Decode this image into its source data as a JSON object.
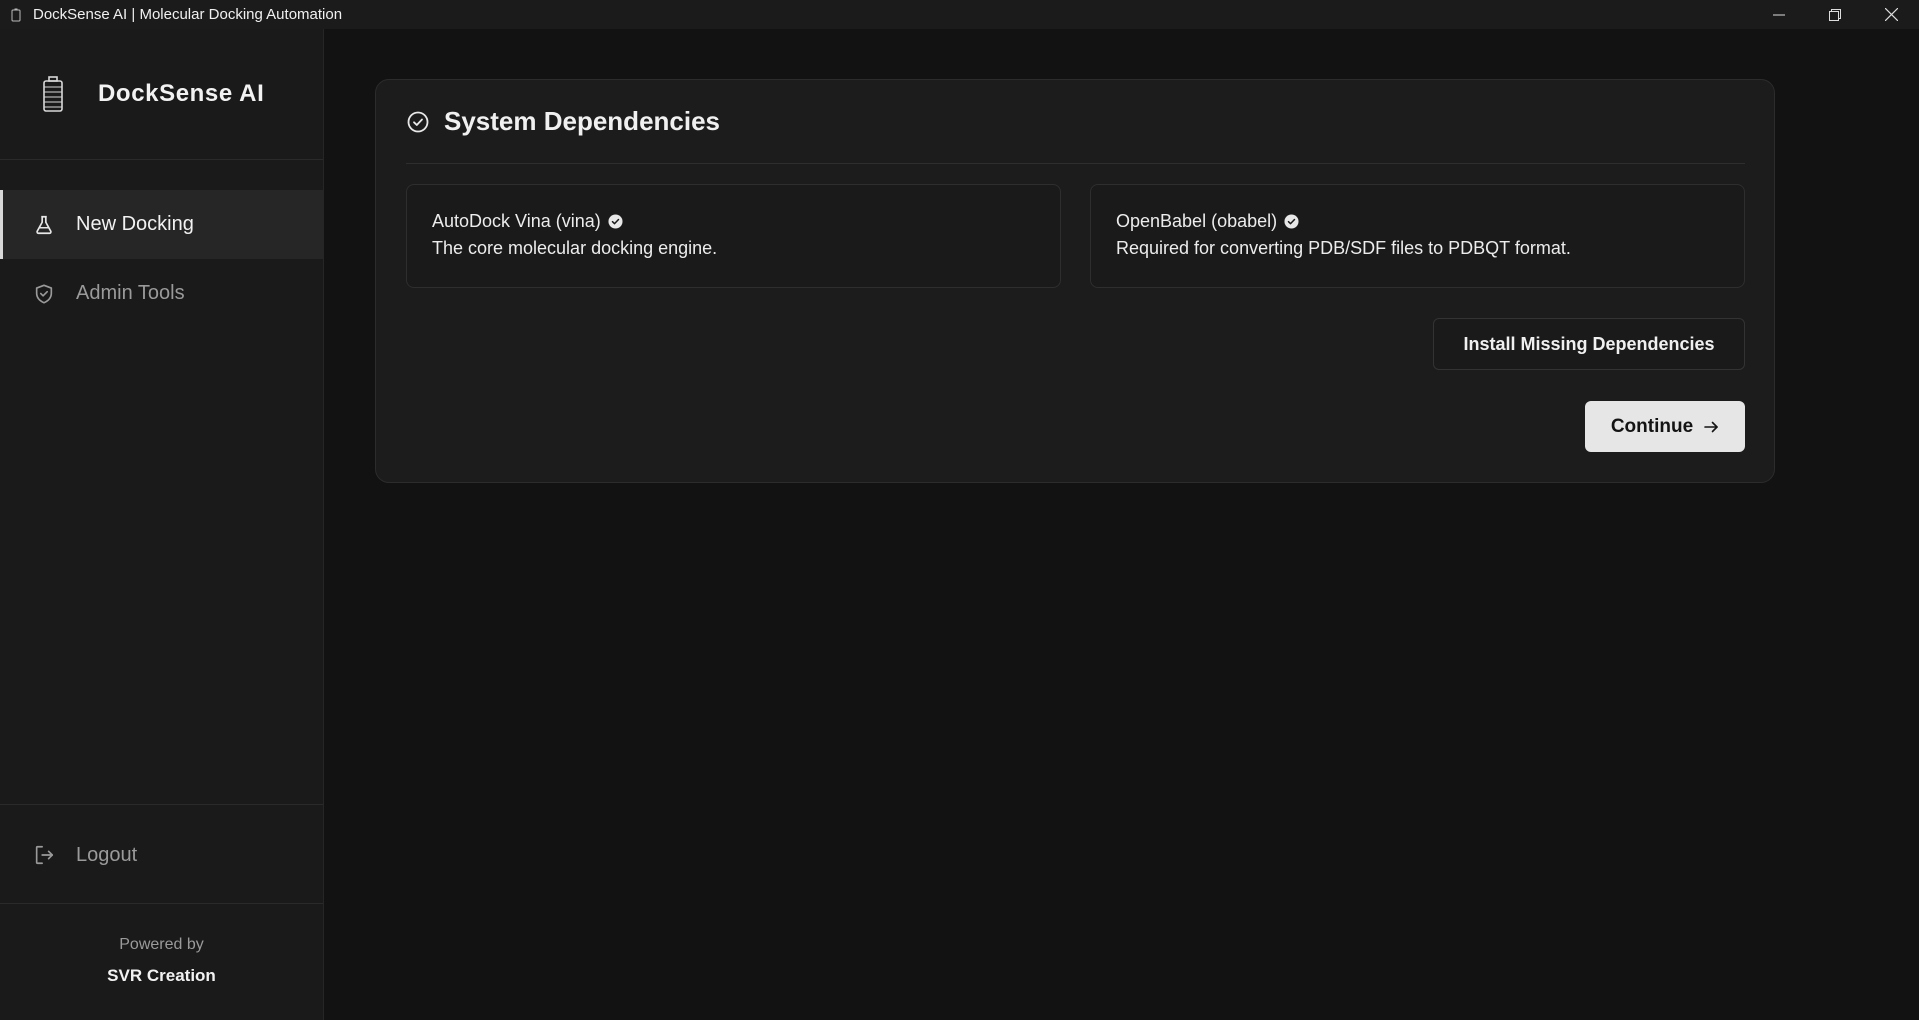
{
  "window": {
    "title": "DockSense AI | Molecular Docking Automation",
    "icons": [
      "app-icon",
      "minimize-icon",
      "maximize-icon",
      "close-icon"
    ]
  },
  "sidebar": {
    "brand": {
      "name": "DockSense AI",
      "icon": "battery-logo-icon"
    },
    "items": [
      {
        "label": "New Docking",
        "icon": "flask-icon",
        "active": true
      },
      {
        "label": "Admin Tools",
        "icon": "shield-check-icon",
        "active": false
      }
    ],
    "logout": {
      "label": "Logout",
      "icon": "logout-icon"
    },
    "footer": {
      "powered_by": "Powered by",
      "company": "SVR Creation"
    }
  },
  "main": {
    "card": {
      "title": "System Dependencies",
      "icon": "check-circle-icon",
      "dependencies": [
        {
          "name": "AutoDock Vina (vina)",
          "description": "The core molecular docking engine.",
          "status_icon": "verified-badge-icon"
        },
        {
          "name": "OpenBabel (obabel)",
          "description": "Required for converting PDB/SDF files to PDBQT format.",
          "status_icon": "verified-badge-icon"
        }
      ],
      "install_button": "Install Missing Dependencies",
      "continue_button": "Continue",
      "continue_icon": "arrow-right-icon"
    }
  },
  "colors": {
    "background": "#121212",
    "sidebar": "#1a1a1a",
    "card": "#1c1c1c",
    "primary_button": "#e6e6e6",
    "text": "#e8e8e8",
    "muted_text": "#9a9a9a"
  }
}
